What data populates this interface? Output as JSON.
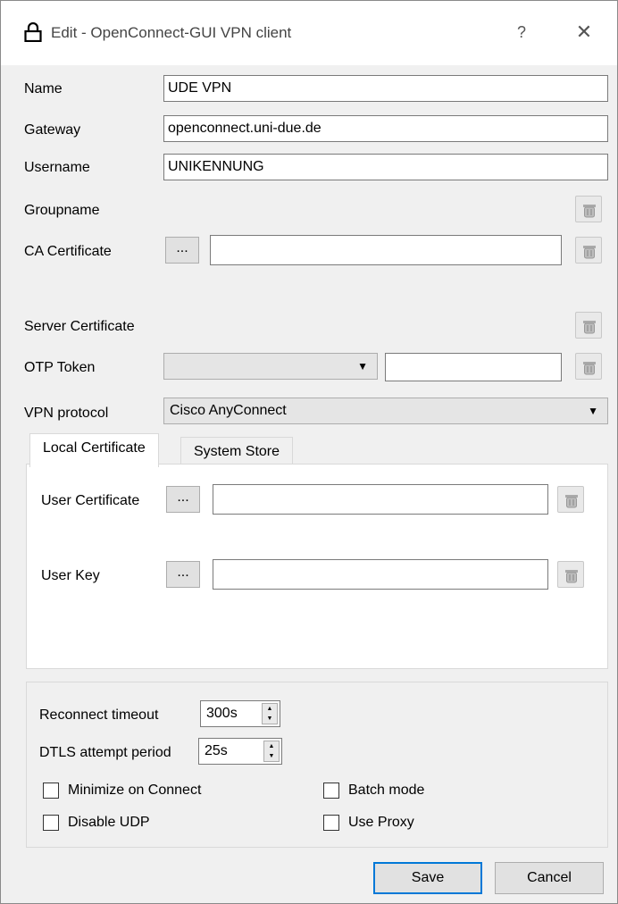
{
  "window": {
    "title": "Edit - OpenConnect-GUI VPN client",
    "help_label": "?",
    "close_label": "✕"
  },
  "form": {
    "name": {
      "label": "Name",
      "value": "UDE VPN"
    },
    "gateway": {
      "label": "Gateway",
      "value": "openconnect.uni-due.de"
    },
    "username": {
      "label": "Username",
      "value": "UNIKENNUNG"
    },
    "groupname": {
      "label": "Groupname"
    },
    "ca_certificate": {
      "label": "CA Certificate",
      "browse_label": "...",
      "value": ""
    },
    "server_certificate": {
      "label": "Server Certificate"
    },
    "otp_token": {
      "label": "OTP Token",
      "selected": "",
      "value": ""
    },
    "vpn_protocol": {
      "label": "VPN protocol",
      "selected": "Cisco AnyConnect"
    }
  },
  "tabs": [
    {
      "label": "Local Certificate",
      "active": true
    },
    {
      "label": "System Store",
      "active": false
    }
  ],
  "local_certificate": {
    "user_certificate": {
      "label": "User Certificate",
      "browse_label": "...",
      "value": ""
    },
    "user_key": {
      "label": "User Key",
      "browse_label": "...",
      "value": ""
    }
  },
  "options": {
    "reconnect_timeout": {
      "label": "Reconnect timeout",
      "value": "300s"
    },
    "dtls_attempt_period": {
      "label": "DTLS attempt period",
      "value": "25s"
    },
    "minimize_on_connect": {
      "label": "Minimize on Connect",
      "checked": false
    },
    "batch_mode": {
      "label": "Batch mode",
      "checked": false
    },
    "disable_udp": {
      "label": "Disable UDP",
      "checked": false
    },
    "use_proxy": {
      "label": "Use Proxy",
      "checked": false
    }
  },
  "buttons": {
    "save": "Save",
    "cancel": "Cancel"
  },
  "colors": {
    "accent": "#0078d7",
    "background": "#f0f0f0"
  }
}
